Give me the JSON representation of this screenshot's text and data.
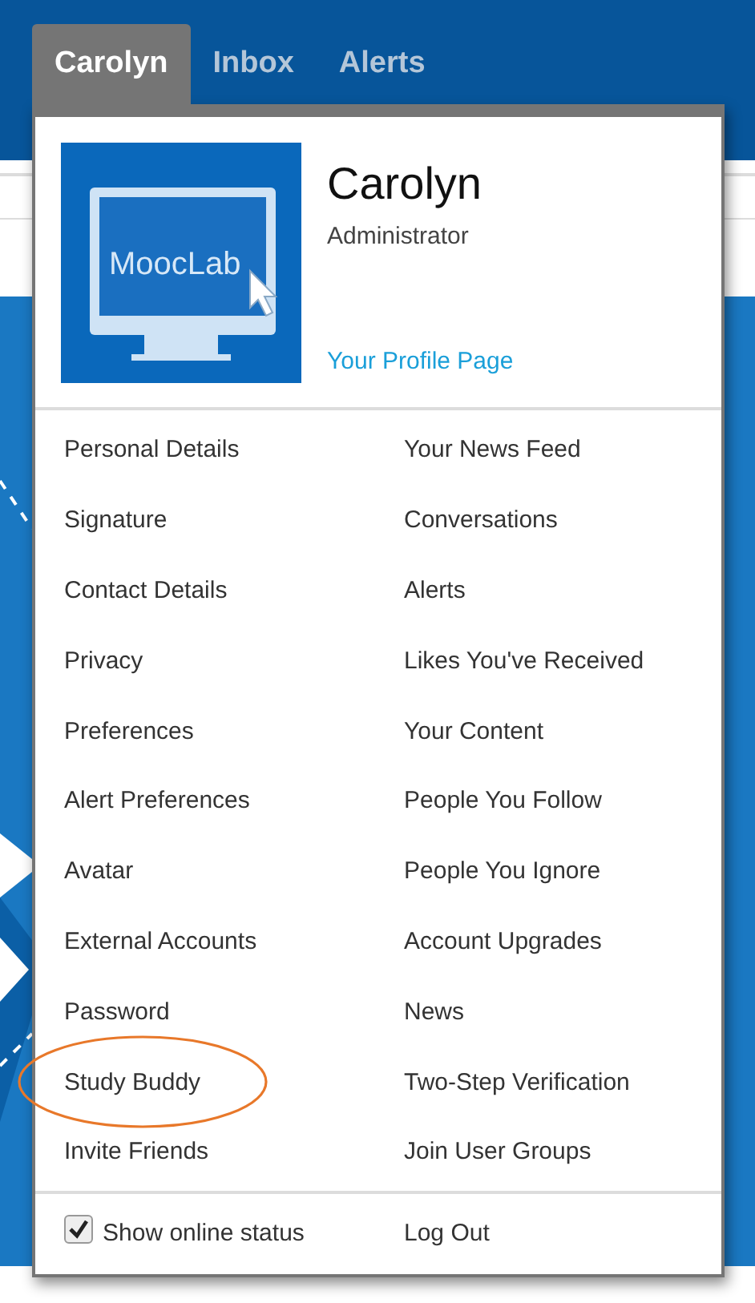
{
  "tabs": [
    {
      "label": "Carolyn",
      "selected": true
    },
    {
      "label": "Inbox",
      "selected": false
    },
    {
      "label": "Alerts",
      "selected": false
    }
  ],
  "profile": {
    "logo_text": "MoocLab",
    "name": "Carolyn",
    "role": "Administrator",
    "link": "Your Profile Page"
  },
  "menu": {
    "columns": [
      [
        {
          "label": "Personal Details",
          "circled": false
        },
        {
          "label": "Signature",
          "circled": false
        },
        {
          "label": "Contact Details",
          "circled": false
        },
        {
          "label": "Privacy",
          "circled": false
        },
        {
          "label": "Preferences",
          "circled": false
        },
        {
          "label": "Alert Preferences",
          "circled": false
        },
        {
          "label": "Avatar",
          "circled": false
        },
        {
          "label": "External Accounts",
          "circled": false
        },
        {
          "label": "Password",
          "circled": false
        },
        {
          "label": "Study Buddy",
          "circled": true
        },
        {
          "label": "Invite Friends",
          "circled": false
        }
      ],
      [
        {
          "label": "Your News Feed",
          "circled": false
        },
        {
          "label": "Conversations",
          "circled": false
        },
        {
          "label": "Alerts",
          "circled": false
        },
        {
          "label": "Likes You've Received",
          "circled": false
        },
        {
          "label": "Your Content",
          "circled": false
        },
        {
          "label": "People You Follow",
          "circled": false
        },
        {
          "label": "People You Ignore",
          "circled": false
        },
        {
          "label": "Account Upgrades",
          "circled": false
        },
        {
          "label": "News",
          "circled": false
        },
        {
          "label": "Two-Step Verification",
          "circled": false
        },
        {
          "label": "Join User Groups",
          "circled": false
        }
      ]
    ]
  },
  "footer": {
    "online_status": {
      "label": "Show online status",
      "checked": true
    },
    "logout": "Log Out"
  }
}
